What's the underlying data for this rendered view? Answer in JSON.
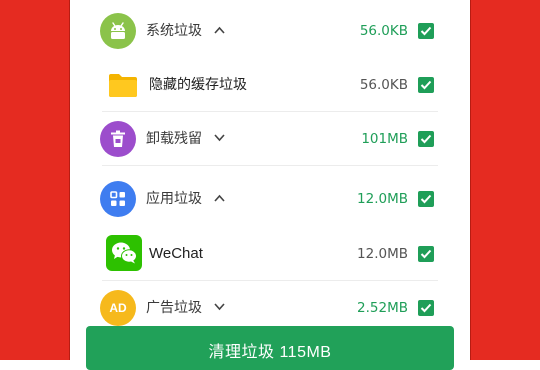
{
  "colors": {
    "accent_green": "#1f9e58",
    "side_red": "#e52b21",
    "android_green": "#8bc34a",
    "residue_purple": "#9c4dcc",
    "app_blue": "#3f7df0",
    "ad_yellow": "#f6b91c",
    "folder_yellow": "#ffc81f",
    "wechat_green": "#2dc100"
  },
  "items": [
    {
      "icon": "android-icon",
      "label": "系统垃圾",
      "chevron": "chevron-up-icon",
      "size": "56.0KB",
      "checked": true
    },
    {
      "icon": "folder-icon",
      "label": "隐藏的缓存垃圾",
      "size": "56.0KB",
      "checked": true
    },
    {
      "icon": "trash-icon",
      "label": "卸载残留",
      "chevron": "chevron-down-icon",
      "size": "101MB",
      "checked": true
    },
    {
      "icon": "apps-icon",
      "label": "应用垃圾",
      "chevron": "chevron-up-icon",
      "size": "12.0MB",
      "checked": true
    },
    {
      "icon": "wechat-icon",
      "label": "WeChat",
      "size": "12.0MB",
      "checked": true
    },
    {
      "icon": "ad-icon",
      "icon_text": "AD",
      "label": "广告垃圾",
      "chevron": "chevron-down-icon",
      "size": "2.52MB",
      "checked": true
    }
  ],
  "clean_button": {
    "label": "清理垃圾 115MB"
  }
}
